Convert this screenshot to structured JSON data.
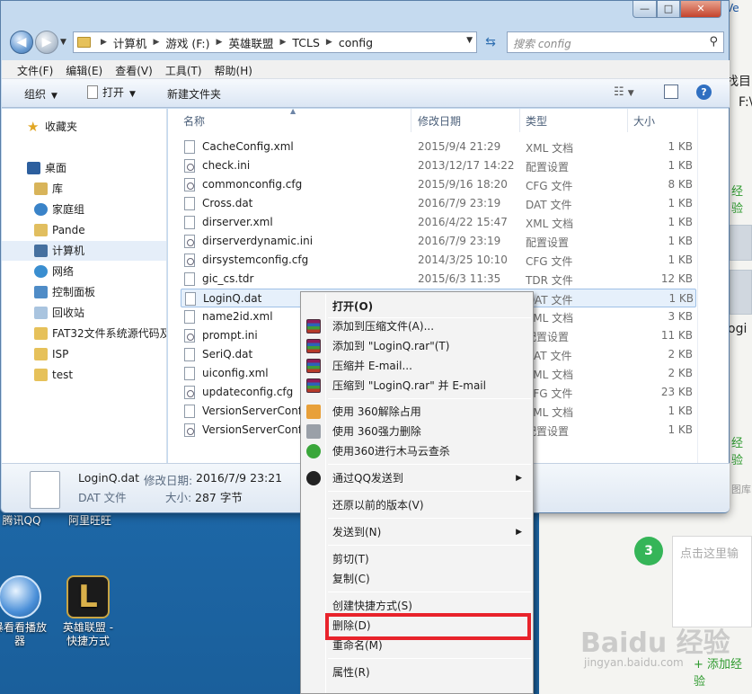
{
  "window": {
    "caption_buttons": {
      "minimize": "—",
      "maximize": "□",
      "close": "✕"
    },
    "nav": {
      "back": "◀",
      "forward": "▶"
    },
    "breadcrumb": [
      "计算机",
      "游戏 (F:)",
      "英雄联盟",
      "TCLS",
      "config"
    ],
    "search_placeholder": "搜索 config",
    "menubar": [
      "文件(F)",
      "编辑(E)",
      "查看(V)",
      "工具(T)",
      "帮助(H)"
    ],
    "toolbar": {
      "organize": "组织",
      "open": "打开",
      "new_folder": "新建文件夹"
    }
  },
  "navpane": {
    "favorites": "收藏夹",
    "desktop": "桌面",
    "items": [
      "库",
      "家庭组",
      "Pande",
      "计算机",
      "网络",
      "控制面板",
      "回收站",
      "FAT32文件系统源代码及",
      "ISP",
      "test"
    ]
  },
  "columns": {
    "name": "名称",
    "date": "修改日期",
    "type": "类型",
    "size": "大小"
  },
  "files": [
    {
      "name": "CacheConfig.xml",
      "date": "2015/9/4 21:29",
      "type": "XML 文档",
      "size": "1 KB"
    },
    {
      "name": "check.ini",
      "date": "2013/12/17 14:22",
      "type": "配置设置",
      "size": "1 KB"
    },
    {
      "name": "commonconfig.cfg",
      "date": "2015/9/16 18:20",
      "type": "CFG 文件",
      "size": "8 KB"
    },
    {
      "name": "Cross.dat",
      "date": "2016/7/9 23:19",
      "type": "DAT 文件",
      "size": "1 KB"
    },
    {
      "name": "dirserver.xml",
      "date": "2016/4/22 15:47",
      "type": "XML 文档",
      "size": "1 KB"
    },
    {
      "name": "dirserverdynamic.ini",
      "date": "2016/7/9 23:19",
      "type": "配置设置",
      "size": "1 KB"
    },
    {
      "name": "dirsystemconfig.cfg",
      "date": "2014/3/25 10:10",
      "type": "CFG 文件",
      "size": "1 KB"
    },
    {
      "name": "gic_cs.tdr",
      "date": "2015/6/3 11:35",
      "type": "TDR 文件",
      "size": "12 KB"
    },
    {
      "name": "LoginQ.dat",
      "date": "",
      "type": "DAT 文件",
      "size": "1 KB"
    },
    {
      "name": "name2id.xml",
      "date": "",
      "type": "XML 文档",
      "size": "3 KB"
    },
    {
      "name": "prompt.ini",
      "date": "",
      "type": "配置设置",
      "size": "11 KB"
    },
    {
      "name": "SeriQ.dat",
      "date": "",
      "type": "DAT 文件",
      "size": "2 KB"
    },
    {
      "name": "uiconfig.xml",
      "date": "",
      "type": "XML 文档",
      "size": "2 KB"
    },
    {
      "name": "updateconfig.cfg",
      "date": "",
      "type": "CFG 文件",
      "size": "23 KB"
    },
    {
      "name": "VersionServerConfig.xml",
      "date": "",
      "type": "XML 文档",
      "size": "1 KB"
    },
    {
      "name": "VersionServerConfig.ini",
      "date": "",
      "type": "配置设置",
      "size": "1 KB"
    }
  ],
  "details": {
    "filename": "LoginQ.dat",
    "modified_label": "修改日期:",
    "modified_value": "2016/7/9 23:21",
    "type": "DAT 文件",
    "size_label": "大小:",
    "size_value": "287 字节"
  },
  "context_menu": [
    "打开(O)",
    "添加到压缩文件(A)...",
    "添加到 \"LoginQ.rar\"(T)",
    "压缩并 E-mail...",
    "压缩到 \"LoginQ.rar\" 并 E-mail",
    "使用 360解除占用",
    "使用 360强力删除",
    "使用360进行木马云查杀",
    "通过QQ发送到",
    "还原以前的版本(V)",
    "发送到(N)",
    "剪切(T)",
    "复制(C)",
    "创建快捷方式(S)",
    "删除(D)",
    "重命名(M)",
    "属性(R)"
  ],
  "desktop_icons": [
    {
      "label": "腾讯QQ"
    },
    {
      "label": "阿里旺旺"
    },
    {
      "label": "看看播放器",
      "label_prefix": "",
      "label_line2": "器",
      "label_line1": "暴看看播放"
    },
    {
      "label_line1": "英雄联盟 -",
      "label_line2": "快捷方式"
    }
  ],
  "webpage": {
    "frag1": "找目",
    "frag2": "F:\\",
    "frag3": "ogi",
    "green1": "经验",
    "green2": "经验",
    "frag_library": "图库",
    "step": "3",
    "input_placeholder": "点击这里输",
    "watermark": "Baidu 经验",
    "watermark_url": "jingyan.baidu.com",
    "add_exp": "+ 添加经验",
    "top_frag": "Ve"
  },
  "colors": {
    "highlight_box": "#e8232b",
    "selection": "#e6f0fb"
  }
}
